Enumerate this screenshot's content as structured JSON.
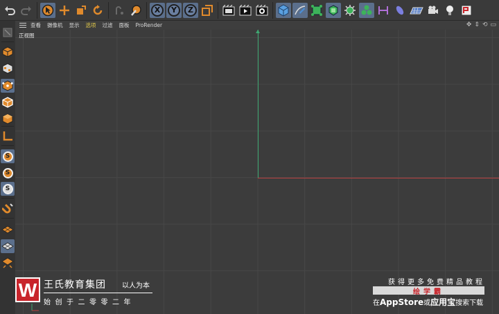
{
  "colors": {
    "accent_highlight": "#5b6f8c",
    "axis_x": "#b84040",
    "axis_y": "#3ea872",
    "active_menu": "#e2c94a",
    "orange_icon": "#e08a2c",
    "brand_red": "#c8242b"
  },
  "toolbar": {
    "items": [
      {
        "icon": "undo-icon"
      },
      {
        "icon": "redo-icon"
      },
      {
        "icon": "select-arrow-icon",
        "highlighted": true
      },
      {
        "icon": "move-icon"
      },
      {
        "icon": "scale-icon"
      },
      {
        "icon": "rotate-icon"
      },
      {
        "icon": "recent-tools-icon"
      },
      {
        "icon": "live-selection-icon"
      },
      {
        "icon": "x-axis-lock",
        "label": "X"
      },
      {
        "icon": "y-axis-lock",
        "label": "Y"
      },
      {
        "icon": "z-axis-lock",
        "label": "Z"
      },
      {
        "icon": "coordinate-system-icon"
      },
      {
        "icon": "render-view-icon"
      },
      {
        "icon": "render-to-picture-viewer-icon"
      },
      {
        "icon": "render-settings-icon"
      },
      {
        "icon": "cube-icon"
      },
      {
        "icon": "pen-spline-icon"
      },
      {
        "icon": "subdivision-icon"
      },
      {
        "icon": "generator-icon"
      },
      {
        "icon": "deformer-icon"
      },
      {
        "icon": "mograph-cloner-icon"
      },
      {
        "icon": "field-icon"
      },
      {
        "icon": "effector-icon"
      },
      {
        "icon": "floor-environment-icon"
      },
      {
        "icon": "camera-icon"
      },
      {
        "icon": "light-icon"
      },
      {
        "icon": "tag-icon"
      }
    ]
  },
  "sidebar": {
    "items": [
      {
        "icon": "make-editable-icon"
      },
      {
        "icon": "model-mode-icon"
      },
      {
        "icon": "texture-mode-icon"
      },
      {
        "icon": "points-mode-icon"
      },
      {
        "icon": "edges-mode-icon"
      },
      {
        "icon": "polygons-mode-icon"
      },
      {
        "icon": "axis-mode-icon"
      },
      {
        "icon": "snapping-icon",
        "label": "S"
      },
      {
        "icon": "snap-enable-icon",
        "label": "S"
      },
      {
        "icon": "quantize-icon",
        "label": "S"
      },
      {
        "icon": "magnet-icon"
      },
      {
        "icon": "workplane-icon"
      },
      {
        "icon": "lock-workplane-icon"
      },
      {
        "icon": "planar-workplane-icon"
      }
    ]
  },
  "viewport_menu": {
    "items": [
      "查看",
      "摄像机",
      "显示",
      "选项",
      "过滤",
      "面板",
      "ProRender"
    ],
    "active_index": 3
  },
  "viewport": {
    "label": "正视图"
  },
  "watermark": {
    "logo_letter": "W",
    "title": "王氏教育集团",
    "slogan": "以人为本",
    "subtitle": "始创于二零零二年",
    "right_line1": "获得更多免费精品教程",
    "right_line2": "绘学霸",
    "right_line3_prefix": "在",
    "right_line3_store": "AppStore",
    "right_line3_or": "或",
    "right_line3_app": "应用宝",
    "right_line3_suffix": "搜索下载"
  }
}
